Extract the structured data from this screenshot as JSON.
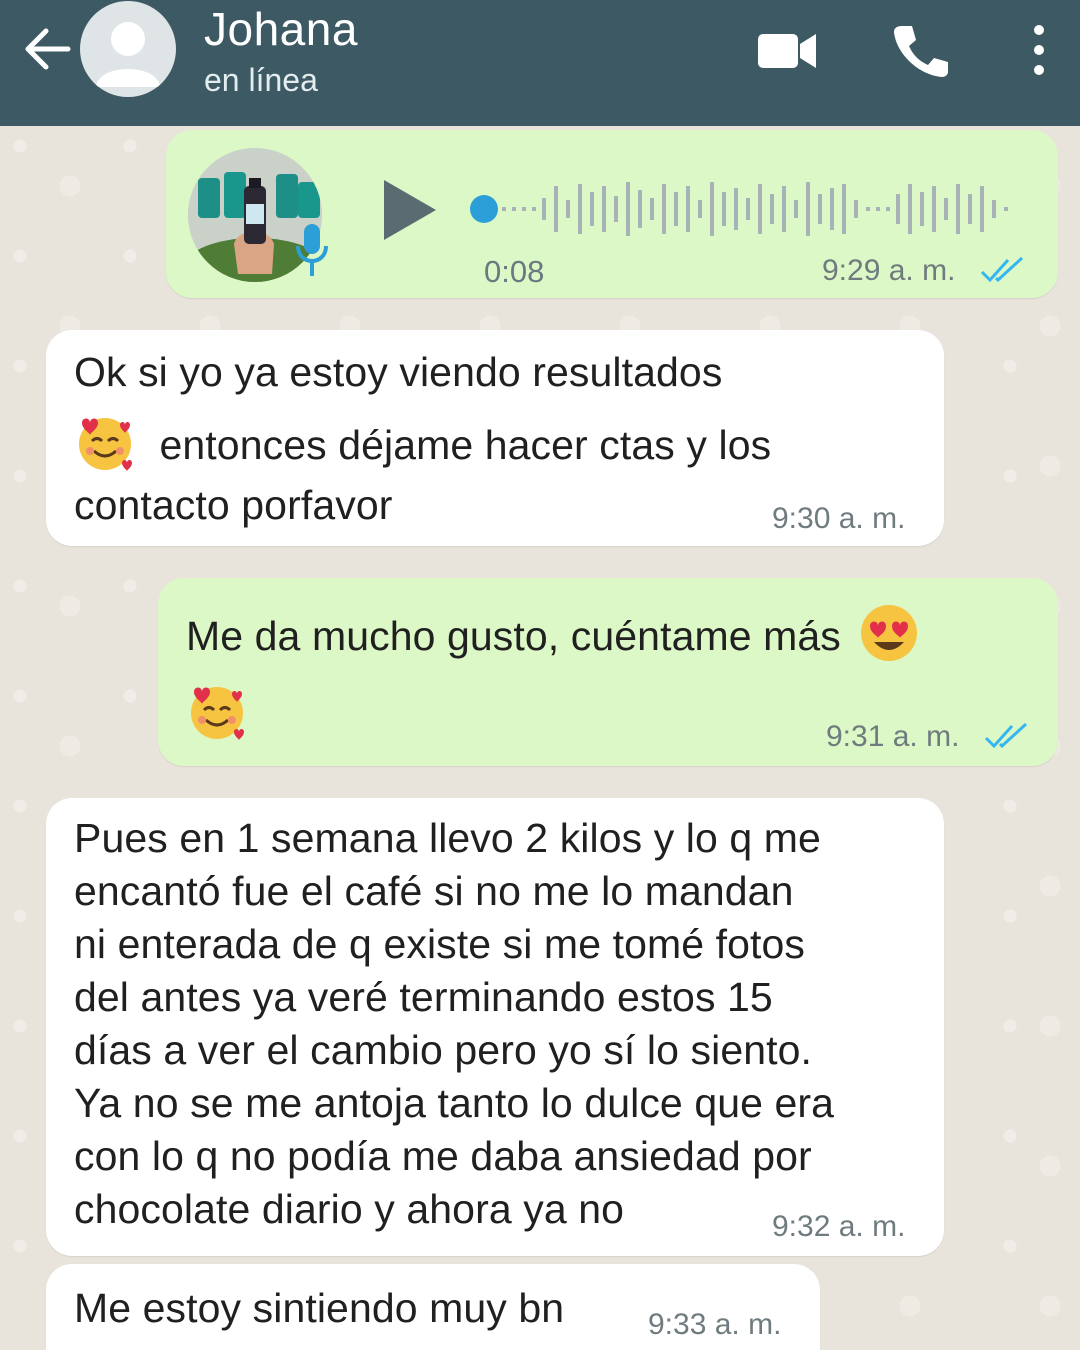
{
  "header": {
    "name": "Johana",
    "status": "en línea"
  },
  "messages": {
    "voice": {
      "duration": "0:08",
      "time": "9:29 a. m.",
      "read": true
    },
    "m1": {
      "line1": "Ok si yo ya estoy viendo resultados",
      "line2": "entonces déjame hacer ctas y los",
      "line3": "contacto porfavor",
      "time": "9:30 a. m."
    },
    "m2": {
      "line1": "Me da mucho gusto, cuéntame más",
      "time": "9:31 a. m.",
      "read": true
    },
    "m3": {
      "line1": "Pues en 1 semana llevo 2 kilos y lo q me",
      "line2": "encantó fue el café si no me lo mandan",
      "line3": "ni enterada de q existe si me tomé fotos",
      "line4": "del antes ya veré terminando estos 15",
      "line5": "días a ver el cambio pero yo sí lo siento.",
      "line6": "Ya no se me antoja tanto lo dulce que era",
      "line7": "con lo q no podía me daba ansiedad por",
      "line8": "chocolate diario y ahora ya no",
      "time": "9:32 a. m."
    },
    "m4": {
      "line1": "Me estoy sintiendo muy bn",
      "time": "9:33 a. m."
    }
  },
  "colors": {
    "header": "#3d5a64",
    "outgoing": "#dcf8c6",
    "incoming": "#ffffff",
    "read_ticks": "#34b7f1"
  },
  "icons": [
    "back-arrow-icon",
    "video-call-icon",
    "phone-icon",
    "more-vert-icon",
    "play-icon",
    "mic-icon",
    "double-check-icon",
    "smiling-face-with-hearts-emoji",
    "heart-eyes-emoji"
  ]
}
